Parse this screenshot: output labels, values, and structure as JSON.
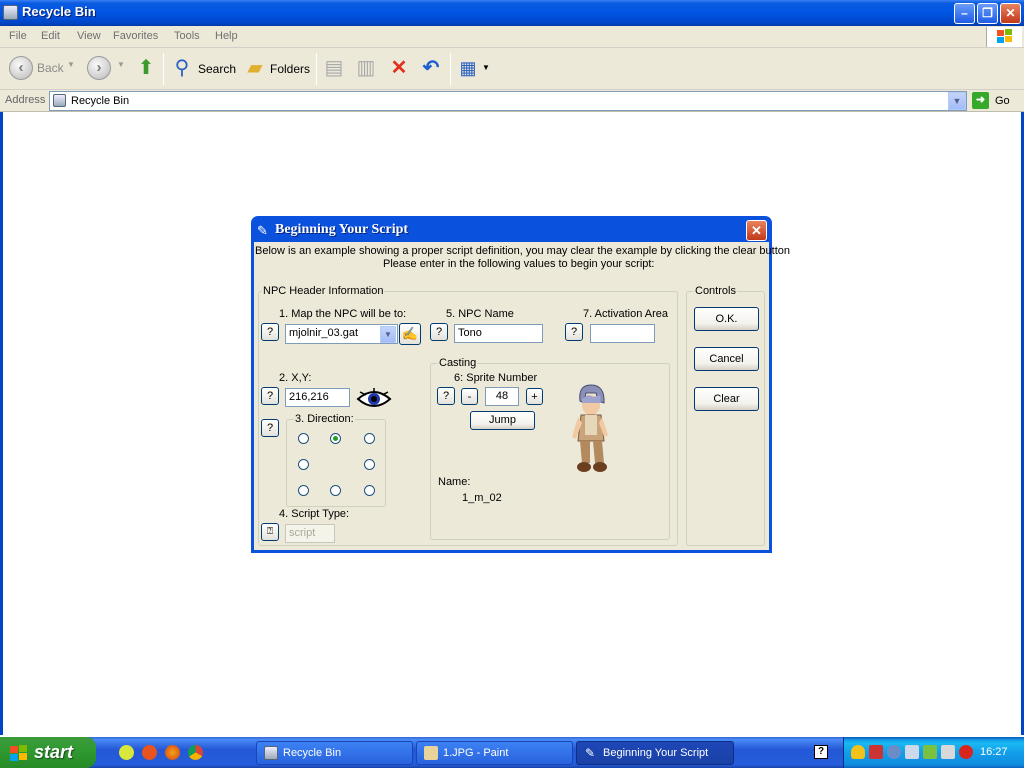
{
  "window": {
    "title": "Recycle Bin"
  },
  "menu": [
    "File",
    "Edit",
    "View",
    "Favorites",
    "Tools",
    "Help"
  ],
  "toolbar": {
    "back": "Back",
    "search": "Search",
    "folders": "Folders"
  },
  "address": {
    "label": "Address",
    "value": "Recycle Bin",
    "go": "Go"
  },
  "dialog": {
    "title": "Beginning Your Script",
    "intro_line1": "Below is an example showing a proper script definition, you may clear the example by clicking the clear button",
    "intro_line2": "Please enter in the following values to begin your script:",
    "npc_group": "NPC Header Information",
    "map_label": "1. Map the NPC will be to:",
    "map_value": "mjolnir_03.gat",
    "npc_name_label": "5. NPC Name",
    "npc_name_value": "Tono",
    "activation_label": "7. Activation Area",
    "activation_value": "",
    "xy_label": "2. X,Y:",
    "xy_value": "216,216",
    "direction_label": "3. Direction:",
    "direction_selected": "N",
    "script_type_label": "4. Script Type:",
    "script_type_value": "script",
    "casting_group": "Casting",
    "sprite_label": "6: Sprite Number",
    "sprite_value": "48",
    "minus": "-",
    "plus": "+",
    "jump": "Jump",
    "name_label": "Name:",
    "name_value": "1_m_02",
    "help": "?",
    "controls_group": "Controls",
    "ok_label": "O.K.",
    "cancel_label": "Cancel",
    "clear_label": "Clear"
  },
  "taskbar": {
    "start": "start",
    "tasks": [
      "Recycle Bin",
      "1.JPG - Paint",
      "Beginning Your Script"
    ],
    "clock": "16:27"
  }
}
